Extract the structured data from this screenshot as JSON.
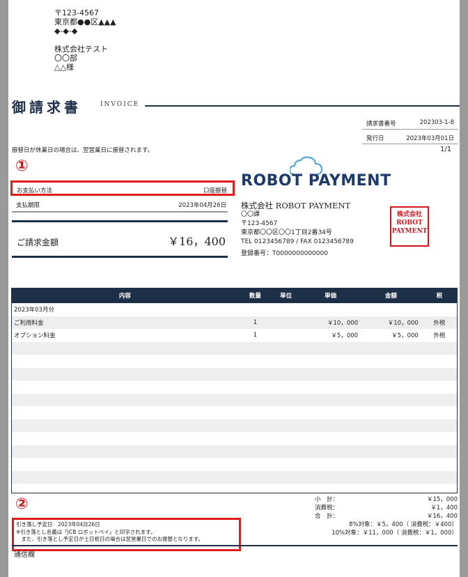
{
  "recipient": {
    "postal": "〒123-4567",
    "address1": "東京都●●区▲▲▲",
    "address2": "◆-◆-◆",
    "company": "株式会社テスト",
    "dept": "〇〇部",
    "person": "△△様"
  },
  "title": "御請求書",
  "title_en": "INVOICE",
  "meta": {
    "invoice_no_label": "請求書番号",
    "invoice_no": "202303-1-8",
    "issue_date_label": "発行日",
    "issue_date": "2023年03月01日"
  },
  "note_top": "振替日が休業日の場合は、翌営業日に振替されます。",
  "page": "1/1",
  "marker1": "①",
  "marker2": "②",
  "payment": {
    "method_label": "お支払い方法",
    "method_value": "口座振替",
    "due_label": "支払期限",
    "due_value": "2023年04月26日",
    "total_label": "ご請求金額",
    "total_value": "￥16，400"
  },
  "sender": {
    "logo_robot": "ROBOT",
    "logo_payment": "PAYMENT",
    "company": "株式会社 ROBOT PAYMENT",
    "dept": "〇〇課",
    "postal": "〒123-4567",
    "address": "東京都〇〇区〇〇1丁目2番34号",
    "tel_fax": "TEL 0123456789 / FAX 0123456789",
    "reg_no": "登録番号：T0000000000000"
  },
  "seal": {
    "line1": "株式会社",
    "line2": "ROBOT",
    "line3": "PAYMENT"
  },
  "colors": {
    "navy": "#1e2f48",
    "red": "#e01b1b",
    "logo_blue": "#1d3a6b",
    "cloud": "#5aa5d9"
  },
  "table": {
    "headers": [
      "内容",
      "数量",
      "単位",
      "単価",
      "金額",
      "税"
    ],
    "rows": [
      [
        "2023年03月分",
        "",
        "",
        "",
        "",
        ""
      ],
      [
        "ご利用料金",
        "1",
        "",
        "￥10，000",
        "￥10，000",
        "外税"
      ],
      [
        "オプション料金",
        "1",
        "",
        "￥5，000",
        "￥5，000",
        "外税"
      ],
      [
        "",
        "",
        "",
        "",
        "",
        ""
      ],
      [
        "",
        "",
        "",
        "",
        "",
        ""
      ],
      [
        "",
        "",
        "",
        "",
        "",
        ""
      ],
      [
        "",
        "",
        "",
        "",
        "",
        ""
      ],
      [
        "",
        "",
        "",
        "",
        "",
        ""
      ],
      [
        "",
        "",
        "",
        "",
        "",
        ""
      ],
      [
        "",
        "",
        "",
        "",
        "",
        ""
      ],
      [
        "",
        "",
        "",
        "",
        "",
        ""
      ],
      [
        "",
        "",
        "",
        "",
        "",
        ""
      ],
      [
        "",
        "",
        "",
        "",
        "",
        ""
      ],
      [
        "",
        "",
        "",
        "",
        "",
        ""
      ]
    ]
  },
  "summary": {
    "subtotal_label": "小　計：",
    "subtotal": "￥15，000",
    "tax_label": "消費税：",
    "tax": "￥1，400",
    "total_label": "合　計：",
    "total": "￥16，400",
    "rate8": "8%対象：￥5，400（ 消費税：￥400）",
    "rate10": "10%対象：￥11，000（ 消費税：￥1，000）"
  },
  "footnote": {
    "line1": "引き落し予定日　2023年04月26日",
    "line2": "※引き落とし名義は「JCB ロボットペイ」と印字されます。",
    "line3": "　また、引き落とし予定日が土日祝日の場合は翌営業日でのお振替となります。"
  },
  "communication": "通信欄"
}
